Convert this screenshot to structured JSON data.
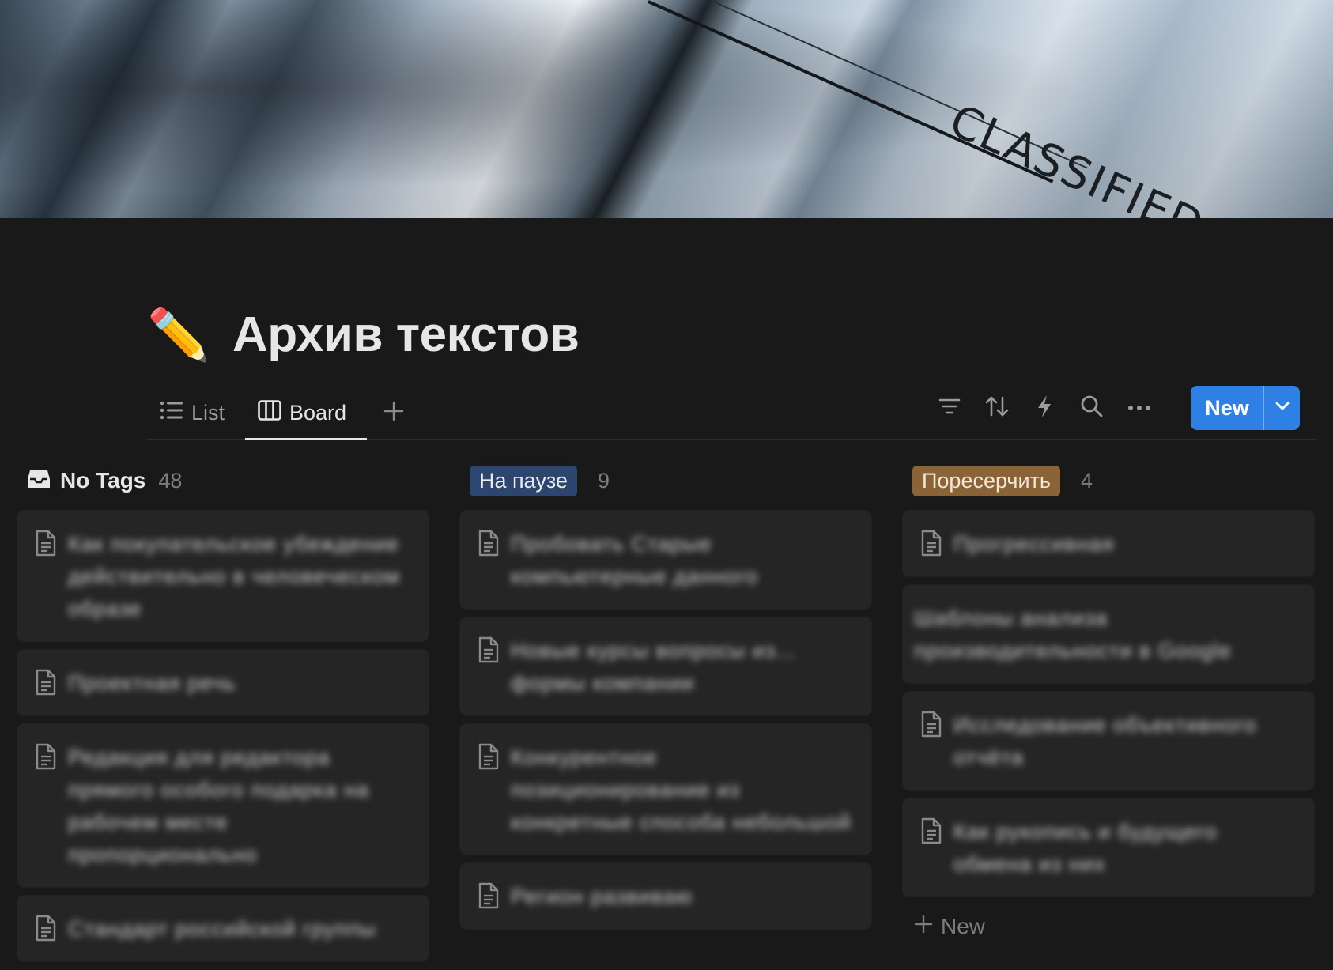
{
  "cover": {
    "stamp_text": "CLASSIFIED"
  },
  "page": {
    "emoji": "✏️",
    "title": "Архив текстов"
  },
  "views": {
    "tabs": [
      {
        "label": "List",
        "icon": "list-icon"
      },
      {
        "label": "Board",
        "icon": "board-icon",
        "active": true
      }
    ],
    "add_icon": "plus-icon"
  },
  "toolbar": {
    "icons": [
      "filter-icon",
      "sort-icon",
      "automation-icon",
      "search-icon",
      "more-icon"
    ],
    "new_label": "New",
    "new_caret_icon": "chevron-down-icon",
    "accent_color": "#2f80e4"
  },
  "board": {
    "columns": [
      {
        "title": "No Tags",
        "count": "48",
        "icon": "inbox-icon",
        "cards": [
          "Как покупательское убеждение действительно в человеческом образе",
          "Проектная речь",
          "Редакция для редактора прямого особого подарка на рабочем месте пропорционально",
          "Стандарт российской группы"
        ]
      },
      {
        "title": "На паузе",
        "count": "9",
        "pill_color": "#2d4670",
        "cards": [
          "Пробовать Старые компьютерные данного",
          "Новые курсы вопросы из... формы компании",
          "Конкурентное позиционирование из конкретные способа небольшой",
          "Регион развиваю"
        ]
      },
      {
        "title": "Поресерчить",
        "count": "4",
        "pill_color": "#8a6336",
        "cards": [
          "Прогрессивная",
          "Шаблоны анализа производительности в Google",
          "Исследование объективного отчёта",
          "Как рукопись и будущего обмена из них"
        ],
        "add_label": "New"
      }
    ]
  }
}
